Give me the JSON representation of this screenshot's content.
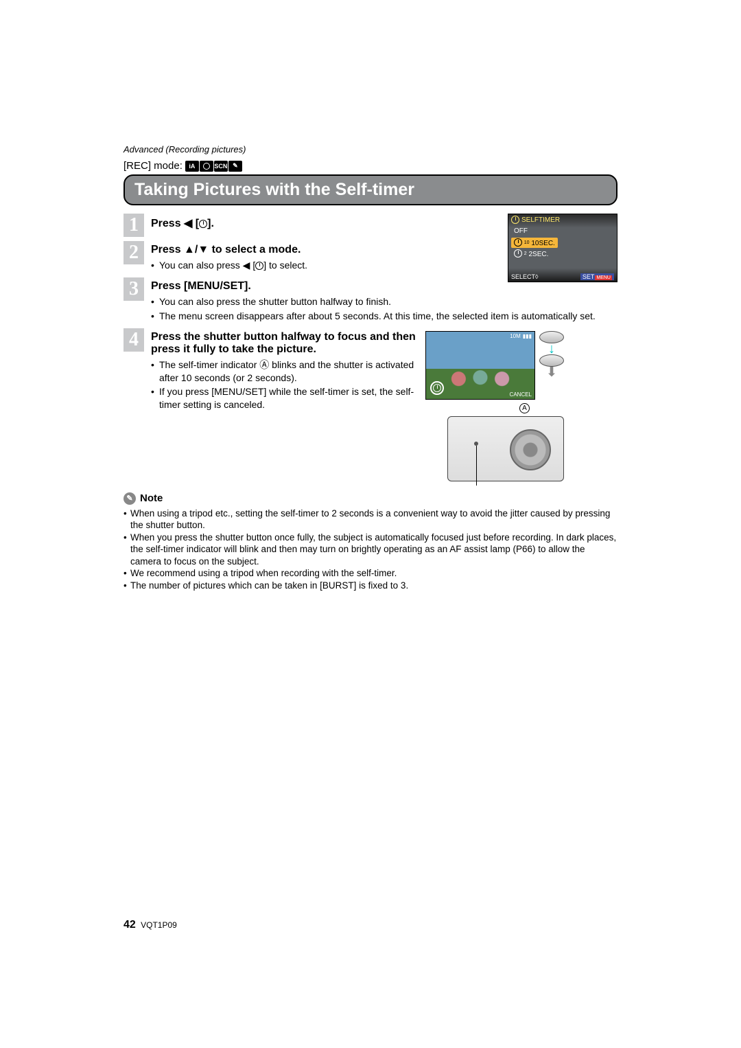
{
  "breadcrumb": "Advanced (Recording pictures)",
  "rec_mode_label": "[REC] mode:",
  "mode_icons": [
    "iA",
    "camera",
    "SCN",
    "clip"
  ],
  "title": "Taking Pictures with the Self-timer",
  "steps": {
    "s1": {
      "num": "1",
      "title_pre": "Press ",
      "title_post": " [",
      "title_end": "]."
    },
    "s2": {
      "num": "2",
      "title": "Press ▲/▼ to select a mode.",
      "b1_pre": "You can also press ◀ [",
      "b1_post": "] to select."
    },
    "s3": {
      "num": "3",
      "title": "Press [MENU/SET].",
      "b1": "You can also press the shutter button halfway to finish.",
      "b2": "The menu screen disappears after about 5 seconds. At this time, the selected item is automatically set."
    },
    "s4": {
      "num": "4",
      "title": "Press the shutter button halfway to focus and then press it fully to take the picture.",
      "b1": "The self-timer indicator Ⓐ blinks and the shutter is activated after 10 seconds (or 2 seconds).",
      "b2": "If you press [MENU/SET] while the self-timer is set, the self-timer setting is canceled."
    }
  },
  "lcd": {
    "title": "SELFTIMER",
    "opt_off": "OFF",
    "opt_10": "10SEC.",
    "opt_2": "2SEC.",
    "bottom_left_pre": "SELECT",
    "bottom_right": "SET"
  },
  "labelA": "A",
  "photo": {
    "cancel": "CANCEL",
    "top1": "10M",
    "top2": ""
  },
  "note_label": "Note",
  "notes": {
    "n1": "When using a tripod etc., setting the self-timer to 2 seconds is a convenient way to avoid the jitter caused by pressing the shutter button.",
    "n2": "When you press the shutter button once fully, the subject is automatically focused just before recording. In dark places, the self-timer indicator will blink and then may turn on brightly operating as an AF assist lamp (P66) to allow the camera to focus on the subject.",
    "n3": "We recommend using a tripod when recording with the self-timer.",
    "n4": "The number of pictures which can be taken in [BURST] is fixed to 3."
  },
  "footer": {
    "page": "42",
    "code": "VQT1P09"
  }
}
